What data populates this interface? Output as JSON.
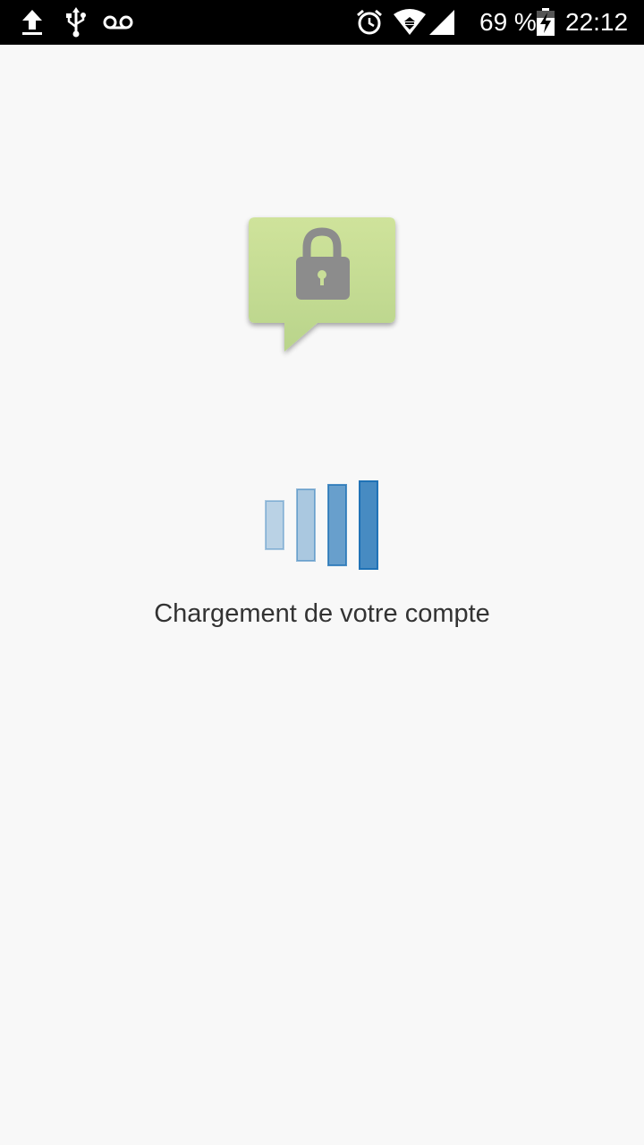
{
  "status_bar": {
    "icons_left": [
      "upload-icon",
      "usb-icon",
      "voicemail-icon"
    ],
    "icons_right": [
      "alarm-icon",
      "wifi-icon",
      "cell-signal-icon",
      "battery-charging-icon"
    ],
    "battery_text": "69 %",
    "battery_level": 0.69,
    "time": "22:12"
  },
  "app_logo": {
    "icon": "lock-icon",
    "bubble_color": "#c4dc94",
    "lock_color": "#8c8c8c"
  },
  "loading": {
    "icon": "loading-bars-icon",
    "bar_color": "#1a6fb4",
    "text": "Chargement de votre compte"
  }
}
